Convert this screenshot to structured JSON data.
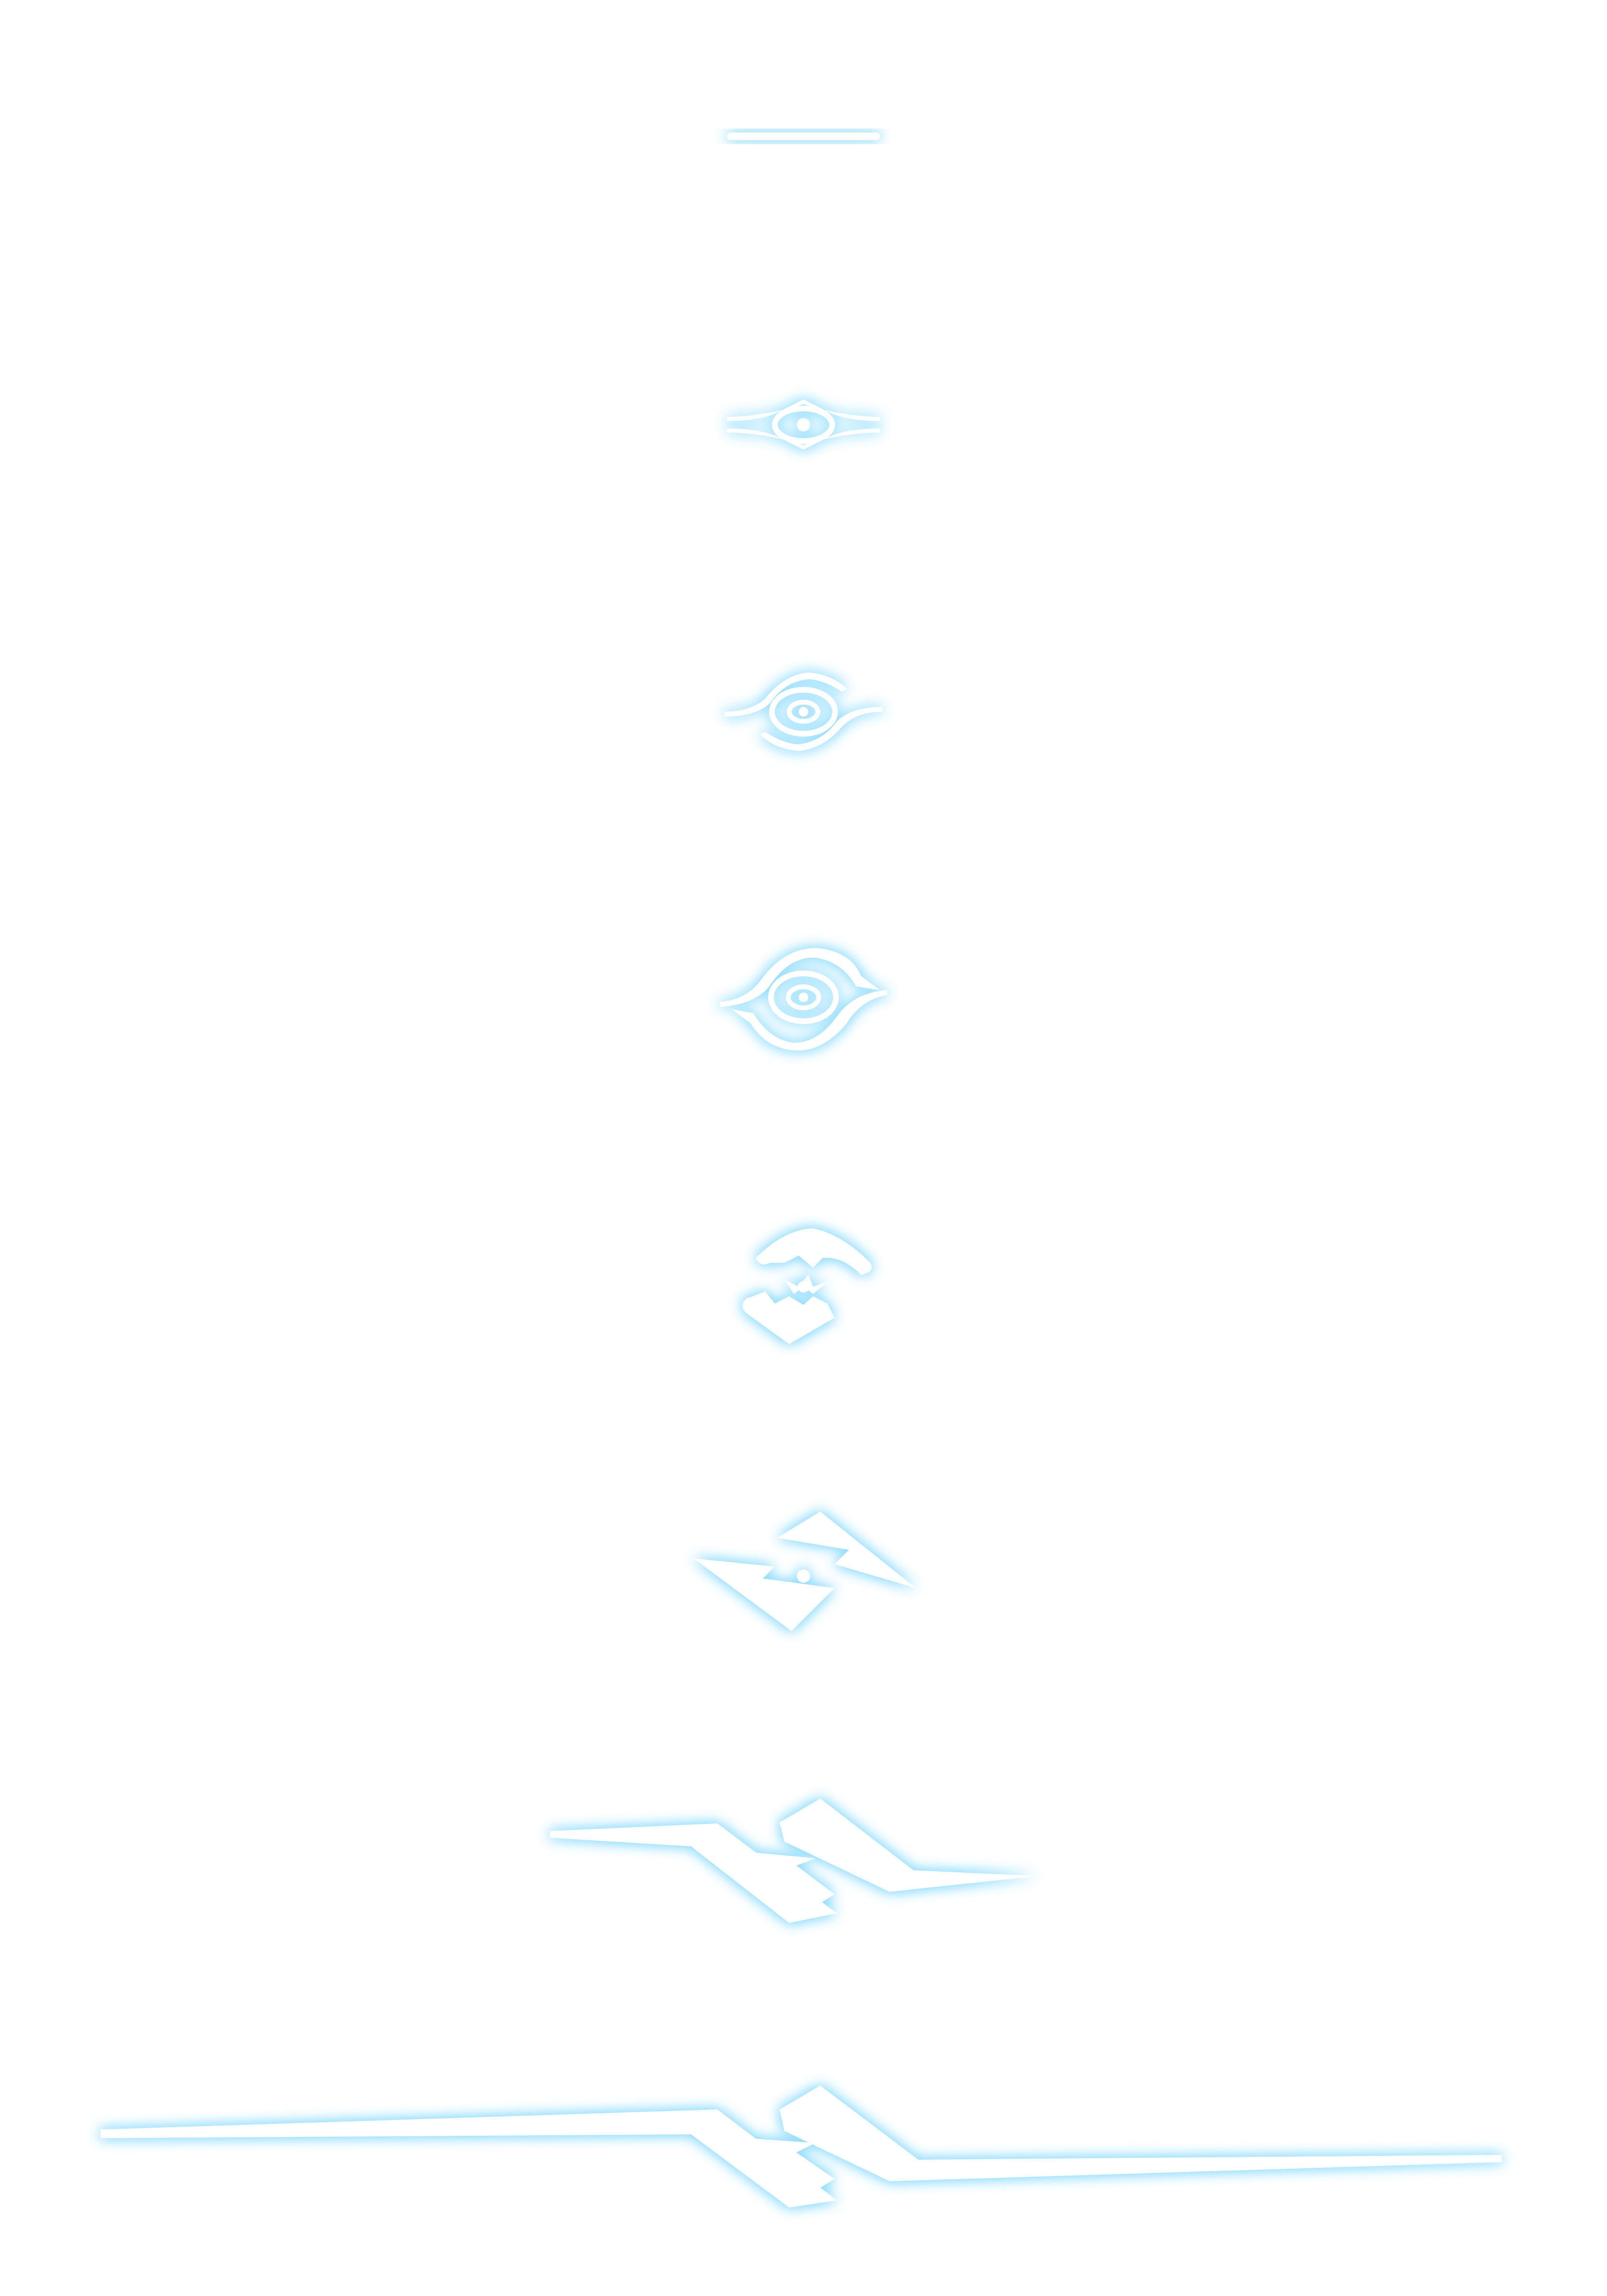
{
  "sprite_sheet": {
    "description_visible_text": "",
    "glow_color": "#8fdcff",
    "core_color": "#ffffff",
    "frames": [
      {
        "name": "frame-1-line",
        "icon": "horizontal-line-icon"
      },
      {
        "name": "frame-2-narrow-eye",
        "icon": "narrow-eye-icon"
      },
      {
        "name": "frame-3-open-eye",
        "icon": "open-eye-icon"
      },
      {
        "name": "frame-4-swirl-eye",
        "icon": "swirl-eye-icon"
      },
      {
        "name": "frame-5-broken-eye",
        "icon": "broken-eye-icon"
      },
      {
        "name": "frame-6-bolt-small",
        "icon": "lightning-bolt-icon"
      },
      {
        "name": "frame-7-bolt-medium",
        "icon": "lightning-bolt-extended-icon"
      },
      {
        "name": "frame-8-bolt-wide",
        "icon": "lightning-bolt-wide-icon"
      }
    ]
  }
}
